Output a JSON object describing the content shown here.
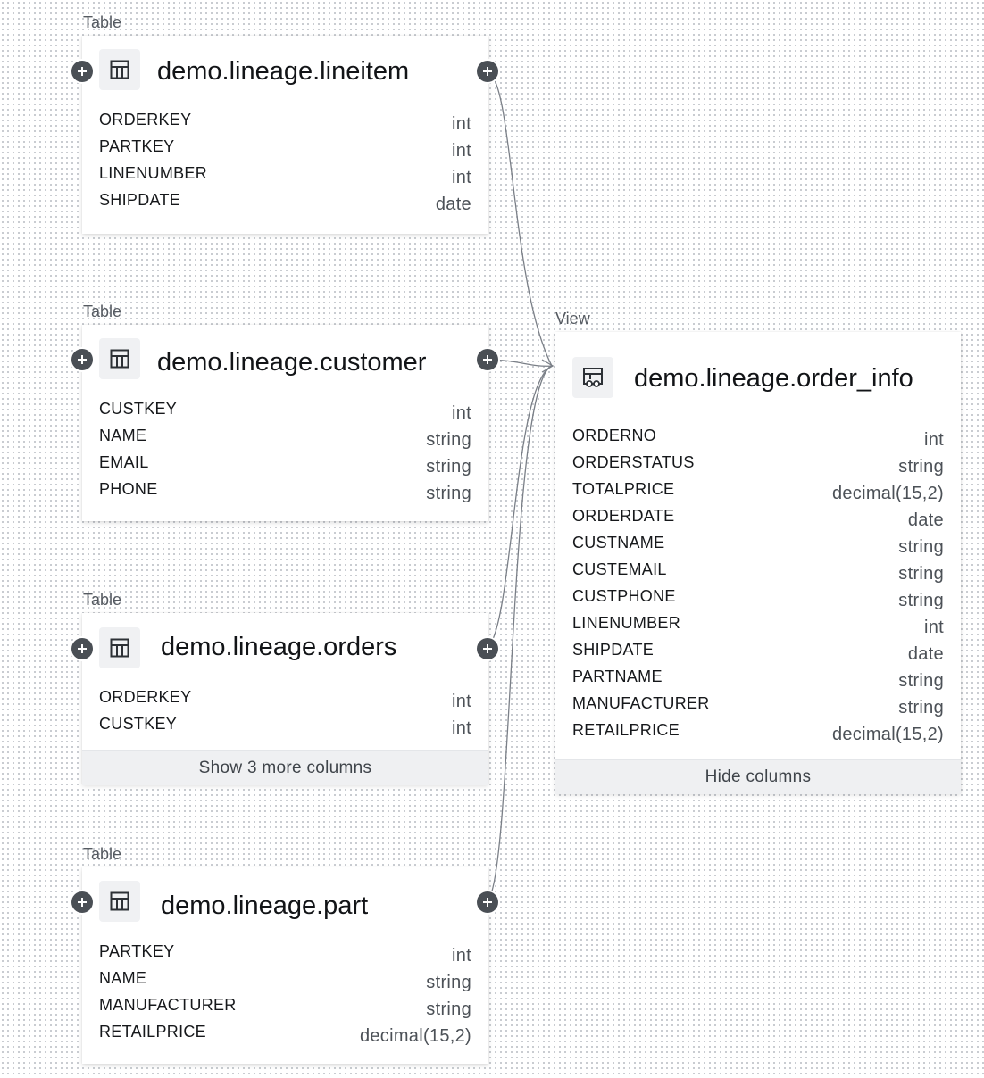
{
  "colors": {
    "edge": "#7a7f87",
    "card_bg": "#ffffff",
    "footer_bg": "#eff0f2",
    "expand_button": "#4a4f55"
  },
  "nodes": {
    "lineitem": {
      "kind": "Table",
      "title": "demo.lineage.lineitem",
      "icon": "table-icon",
      "columns": [
        {
          "name": "ORDERKEY",
          "type": "int"
        },
        {
          "name": "PARTKEY",
          "type": "int"
        },
        {
          "name": "LINENUMBER",
          "type": "int"
        },
        {
          "name": "SHIPDATE",
          "type": "date"
        }
      ]
    },
    "customer": {
      "kind": "Table",
      "title": "demo.lineage.customer",
      "icon": "table-icon",
      "columns": [
        {
          "name": "CUSTKEY",
          "type": "int"
        },
        {
          "name": "NAME",
          "type": "string"
        },
        {
          "name": "EMAIL",
          "type": "string"
        },
        {
          "name": "PHONE",
          "type": "string"
        }
      ]
    },
    "orders": {
      "kind": "Table",
      "title": "demo.lineage.orders",
      "icon": "table-icon",
      "columns": [
        {
          "name": "ORDERKEY",
          "type": "int"
        },
        {
          "name": "CUSTKEY",
          "type": "int"
        }
      ],
      "footer": "Show 3 more columns"
    },
    "part": {
      "kind": "Table",
      "title": "demo.lineage.part",
      "icon": "table-icon",
      "columns": [
        {
          "name": "PARTKEY",
          "type": "int"
        },
        {
          "name": "NAME",
          "type": "string"
        },
        {
          "name": "MANUFACTURER",
          "type": "string"
        },
        {
          "name": "RETAILPRICE",
          "type": "decimal(15,2)"
        }
      ]
    },
    "order_info": {
      "kind": "View",
      "title": "demo.lineage.order_info",
      "icon": "view-icon",
      "columns": [
        {
          "name": "ORDERNO",
          "type": "int"
        },
        {
          "name": "ORDERSTATUS",
          "type": "string"
        },
        {
          "name": "TOTALPRICE",
          "type": "decimal(15,2)"
        },
        {
          "name": "ORDERDATE",
          "type": "date"
        },
        {
          "name": "CUSTNAME",
          "type": "string"
        },
        {
          "name": "CUSTEMAIL",
          "type": "string"
        },
        {
          "name": "CUSTPHONE",
          "type": "string"
        },
        {
          "name": "LINENUMBER",
          "type": "int"
        },
        {
          "name": "SHIPDATE",
          "type": "date"
        },
        {
          "name": "PARTNAME",
          "type": "string"
        },
        {
          "name": "MANUFACTURER",
          "type": "string"
        },
        {
          "name": "RETAILPRICE",
          "type": "decimal(15,2)"
        }
      ],
      "footer": "Hide columns"
    }
  }
}
